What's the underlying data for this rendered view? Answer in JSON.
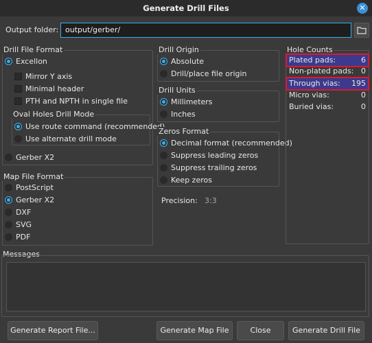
{
  "window": {
    "title": "Generate Drill Files"
  },
  "output": {
    "label": "Output folder:",
    "value": "output/gerber/"
  },
  "drill_file_format": {
    "title": "Drill File Format",
    "excellon": "Excellon",
    "mirror_y": "Mirror Y axis",
    "minimal_header": "Minimal header",
    "pth_npth": "PTH and NPTH in single file",
    "oval_title": "Oval Holes Drill Mode",
    "route": "Use route command (recommended)",
    "alt_drill": "Use alternate drill mode",
    "gerber_x2": "Gerber X2"
  },
  "map_file_format": {
    "title": "Map File Format",
    "options": [
      "PostScript",
      "Gerber X2",
      "DXF",
      "SVG",
      "PDF"
    ],
    "selected": "Gerber X2"
  },
  "drill_origin": {
    "title": "Drill Origin",
    "absolute": "Absolute",
    "place": "Drill/place file origin"
  },
  "drill_units": {
    "title": "Drill Units",
    "mm": "Millimeters",
    "inches": "Inches"
  },
  "zeros_format": {
    "title": "Zeros Format",
    "decimal": "Decimal format (recommended)",
    "leading": "Suppress leading zeros",
    "trailing": "Suppress trailing zeros",
    "keep": "Keep zeros"
  },
  "precision": {
    "label": "Precision:",
    "value": "3:3"
  },
  "hole_counts": {
    "title": "Hole Counts",
    "plated_label": "Plated pads:",
    "plated": "6",
    "nonplated_label": "Non-plated pads:",
    "nonplated": "0",
    "through_label": "Through vias:",
    "through": "195",
    "micro_label": "Micro vias:",
    "micro": "0",
    "buried_label": "Buried vias:",
    "buried": "0"
  },
  "messages": {
    "title": "Messages"
  },
  "buttons": {
    "report": "Generate Report File...",
    "map": "Generate Map File",
    "close": "Close",
    "drill": "Generate Drill File"
  },
  "colors": {
    "accent": "#3daee9",
    "highlight": "#3b3a8e",
    "annotation": "#e0182d"
  }
}
